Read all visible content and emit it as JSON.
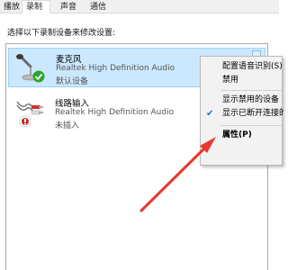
{
  "tabs": [
    {
      "label": "播放"
    },
    {
      "label": "录制"
    },
    {
      "label": "声音"
    },
    {
      "label": "通信"
    }
  ],
  "instruction": "选择以下录制设备来修改设置:",
  "devices": [
    {
      "name": "麦克风",
      "driver": "Realtek High Definition Audio",
      "status": "默认设备",
      "icon": "microphone-icon",
      "selected": true
    },
    {
      "name": "线路输入",
      "driver": "Realtek High Definition Audio",
      "status": "未插入",
      "icon": "line-in-icon",
      "selected": false
    }
  ],
  "context_menu": {
    "items": [
      {
        "label": "配置语音识别(S)"
      },
      {
        "label": "禁用"
      },
      {
        "label": "显示禁用的设备"
      },
      {
        "label": "显示已断开连接的设备",
        "checked": true
      },
      {
        "label": "属性(P)",
        "bold": true
      }
    ]
  },
  "colors": {
    "selection": "#cce8ff",
    "annotation_arrow": "#e8382f",
    "default_badge": "#2aa52a"
  }
}
